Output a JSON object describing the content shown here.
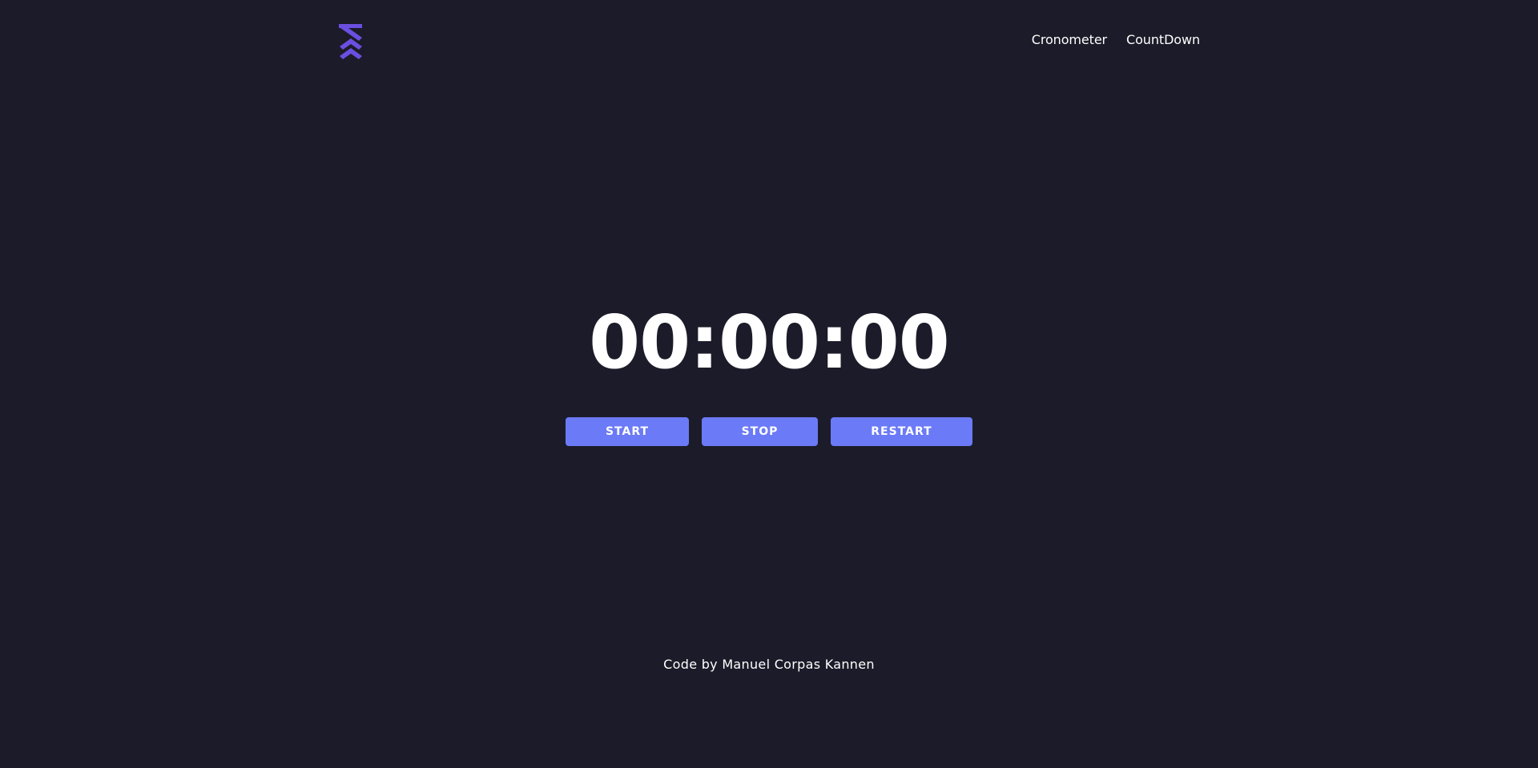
{
  "header": {
    "logo_icon": "mk-logo-icon",
    "logo_color": "#6b4fe0",
    "nav": [
      {
        "label": "Cronometer"
      },
      {
        "label": "CountDown"
      }
    ]
  },
  "main": {
    "timer_display": "00:00:00",
    "buttons": {
      "start_label": "START",
      "stop_label": "STOP",
      "restart_label": "RESTART"
    },
    "button_color": "#6b7af6"
  },
  "footer": {
    "credit": "Code by Manuel Corpas Kannen"
  },
  "theme": {
    "background": "#1c1b29",
    "text": "#ffffff"
  }
}
